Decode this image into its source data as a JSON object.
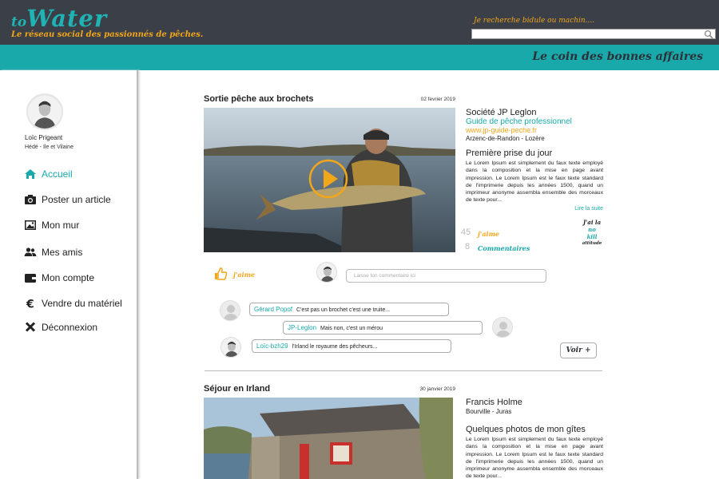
{
  "header": {
    "logo_to": "to",
    "logo_water": "Water",
    "tagline": "Le réseau social des passionnés de pêches.",
    "search_label": "Je recherche bidule ou machin....",
    "search_value": "",
    "deals_link": "Le coin des bonnes affaires"
  },
  "user": {
    "name": "Loïc Prigeant",
    "location": "Hédé - Ile et Vilaine"
  },
  "nav": [
    {
      "label": "Accueil",
      "icon": "home-icon",
      "active": true
    },
    {
      "label": "Poster un article",
      "icon": "camera-icon",
      "active": false
    },
    {
      "label": "Mon mur",
      "icon": "image-icon",
      "active": false
    },
    {
      "label": "Mes amis",
      "icon": "users-icon",
      "active": false
    },
    {
      "label": "Mon compte",
      "icon": "wallet-icon",
      "active": false
    },
    {
      "label": "Vendre du matériel",
      "icon": "euro-icon",
      "active": false
    },
    {
      "label": "Déconnexion",
      "icon": "close-icon",
      "active": false
    }
  ],
  "posts": [
    {
      "title": "Sortie pêche aux brochets",
      "date": "02 fevrier 2019",
      "company": "Société JP Leglon",
      "company_role": "Guide de pêche professionnel",
      "website": "www.jp-guide-peche.fr",
      "place": "Arzenc-de-Randon - Lozère",
      "section_title": "Première prise du jour",
      "body": "Le Lorem Ipsum est simplement du faux texte employé dans la composition et la mise en page avant impression. Le Lorem Ipsum est le faux texte standard de l'imprimerie depuis les années 1500, quand un imprimeur anonyme assembla ensemble des morceaux de texte pour...",
      "read_more": "Lire la suite",
      "likes_count": "45",
      "likes_label": "j'aime",
      "comments_count": "8",
      "comments_label": "Commentaires",
      "nokill_line1": "J'ai la",
      "nokill_line2": "no",
      "nokill_line3": "kill",
      "nokill_line4": "attitude",
      "like_button_label": "j'aime",
      "comment_placeholder": "Laisse ton commentaire ici",
      "comments": [
        {
          "author": "Gérard Popof",
          "text": "C'est pas un brochet c'est une truite..."
        },
        {
          "author": "JP-Leglon",
          "text": "Mais non, c'est un mérou"
        },
        {
          "author": "Loïc-bzh29",
          "text": "l'Irland le royaume des pêcheurs..."
        }
      ],
      "see_more": "Voir +"
    },
    {
      "title": "Séjour en Irland",
      "date": "30 janvier 2019",
      "author": "Francis Holme",
      "place": "Bourville - Juras",
      "section_title": "Quelques photos de mon gîtes",
      "body": "Le Lorem Ipsum est simplement du faux texte employé dans la composition et la mise en page avant impression. Le Lorem Ipsum est le faux texte standard de l'imprimerie depuis les années 1500, quand un imprimeur anonyme assembla ensemble des morceaux de texte pour..."
    }
  ],
  "colors": {
    "teal": "#19a9ab",
    "orange": "#f2a61a",
    "dark": "#3b3f48"
  }
}
